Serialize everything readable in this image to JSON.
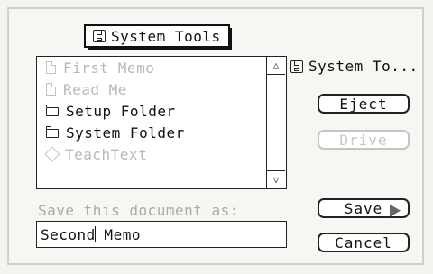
{
  "popup": {
    "label": "System Tools",
    "icon": "disk-icon"
  },
  "file_list": [
    {
      "label": "First Memo",
      "icon": "document-icon",
      "dimmed": true
    },
    {
      "label": "Read Me",
      "icon": "document-icon",
      "dimmed": true
    },
    {
      "label": "Setup Folder",
      "icon": "folder-icon",
      "dimmed": false
    },
    {
      "label": "System Folder",
      "icon": "folder-icon",
      "dimmed": false
    },
    {
      "label": "TeachText",
      "icon": "application-icon",
      "dimmed": true
    }
  ],
  "volume": {
    "label": "System To...",
    "icon": "disk-icon"
  },
  "buttons": {
    "eject": "Eject",
    "drive": "Drive",
    "save": "Save",
    "cancel": "Cancel"
  },
  "save_prompt": "Save this document as:",
  "filename": {
    "before_caret": "Second",
    "after_caret": " Memo"
  }
}
